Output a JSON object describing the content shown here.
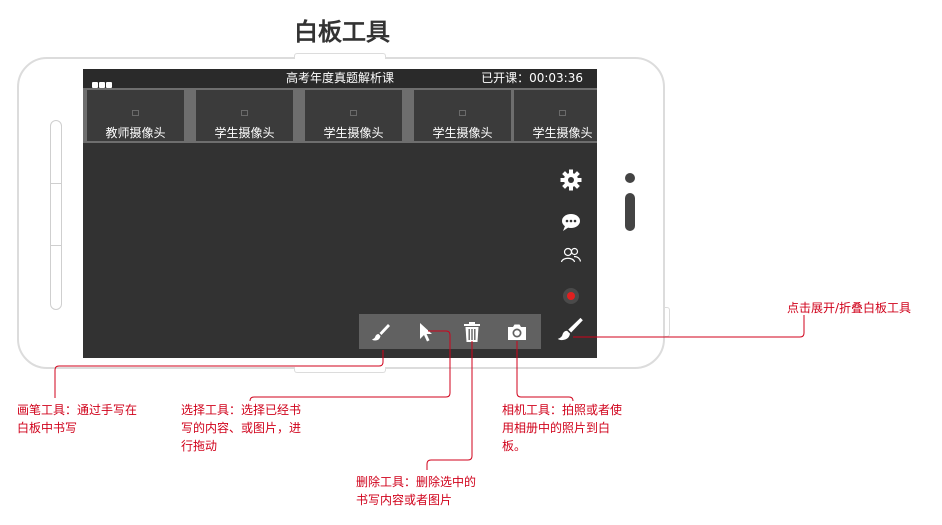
{
  "page_title": "白板工具",
  "screen": {
    "course_title": "高考年度真题解析课",
    "timer": "已开课：00:03:36",
    "video_tiles": [
      {
        "label": "教师摄像头"
      },
      {
        "label": "学生摄像头"
      },
      {
        "label": "学生摄像头"
      },
      {
        "label": "学生摄像头"
      },
      {
        "label": "学生摄像头"
      }
    ],
    "side_icons": [
      "gear-icon",
      "chat-bubble-icon",
      "users-icon",
      "record-icon",
      "brush-toggle-icon"
    ],
    "toolbar_tools": [
      "brush-icon",
      "cursor-icon",
      "trash-icon",
      "camera-icon"
    ]
  },
  "annotations": {
    "toggle": "点击展开/折叠白板工具",
    "brush": "画笔工具：通过手写在\n白板中书写",
    "select": "选择工具：选择已经书\n写的内容、或图片，进\n行拖动",
    "delete": "删除工具：删除选中的\n书写内容或者图片",
    "camera": "相机工具：拍照或者使\n用相册中的照片到白\n板。"
  },
  "colors": {
    "annotation": "#d0021b",
    "screen_bg": "#323232",
    "toolbar_bg": "#616161",
    "record_dot": "#e02020"
  }
}
